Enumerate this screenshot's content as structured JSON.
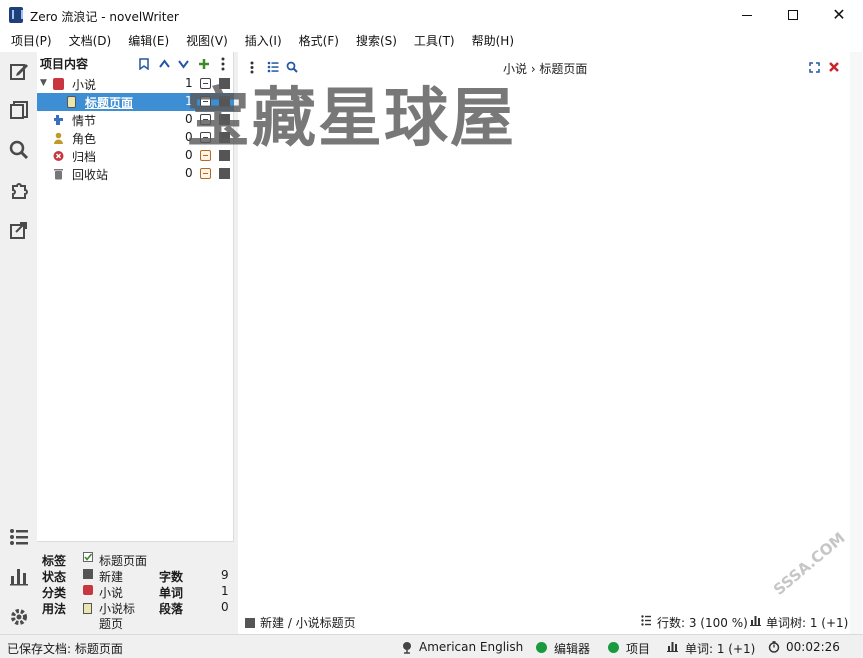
{
  "window": {
    "title": "Zero 流浪记 - novelWriter",
    "min_glyph": "—",
    "max_glyph": "☐",
    "close_glyph": "✕"
  },
  "menu": [
    "项目(P)",
    "文档(D)",
    "编辑(E)",
    "视图(V)",
    "插入(I)",
    "格式(F)",
    "搜索(S)",
    "工具(T)",
    "帮助(H)"
  ],
  "sidebar_icons": [
    "edit-icon",
    "documents-icon",
    "search-icon",
    "plugin-icon",
    "export-icon",
    "outline-icon",
    "stats-icon",
    "settings-icon"
  ],
  "tree": {
    "header": "项目内容",
    "rows": [
      {
        "label": "小说",
        "count": "1",
        "icon": "red-book"
      },
      {
        "label": "标题页面",
        "count": "1",
        "icon": "doc",
        "selected": true
      },
      {
        "label": "情节",
        "count": "0",
        "icon": "plot"
      },
      {
        "label": "角色",
        "count": "0",
        "icon": "person"
      },
      {
        "label": "归档",
        "count": "0",
        "icon": "archive"
      },
      {
        "label": "回收站",
        "count": "0",
        "icon": "trash"
      }
    ]
  },
  "details": {
    "label_tag": "标签",
    "label_status": "状态",
    "label_class": "分类",
    "label_usage": "用法",
    "tag_value": "标题页面",
    "status_value": "新建",
    "class_value": "小说",
    "usage_value_1": "小说标",
    "usage_value_2": "题页",
    "chars_label": "字数",
    "chars_value": "9",
    "words_label": "单词",
    "words_value": "1",
    "paras_label": "段落",
    "paras_value": "0"
  },
  "editor": {
    "breadcrumb": "小说 › 标题页面",
    "footer_status": "新建 / 小说标题页",
    "footer_lines": "行数: 3 (100 %)",
    "footer_words": "单词树: 1 (+1)"
  },
  "statusbar": {
    "saved": "已保存文档: 标题页面",
    "language": "American English",
    "editor": "编辑器",
    "project": "项目",
    "words": "单词: 1 (+1)",
    "time": "00:02:26"
  },
  "watermark": {
    "text": "宝藏星球屋",
    "corner": "SSSA.COM"
  },
  "colors": {
    "selection": "#3e8ed4",
    "status_green": "#1a9a3f",
    "novel_red": "#c8363f",
    "accent_blue": "#2456a6"
  }
}
